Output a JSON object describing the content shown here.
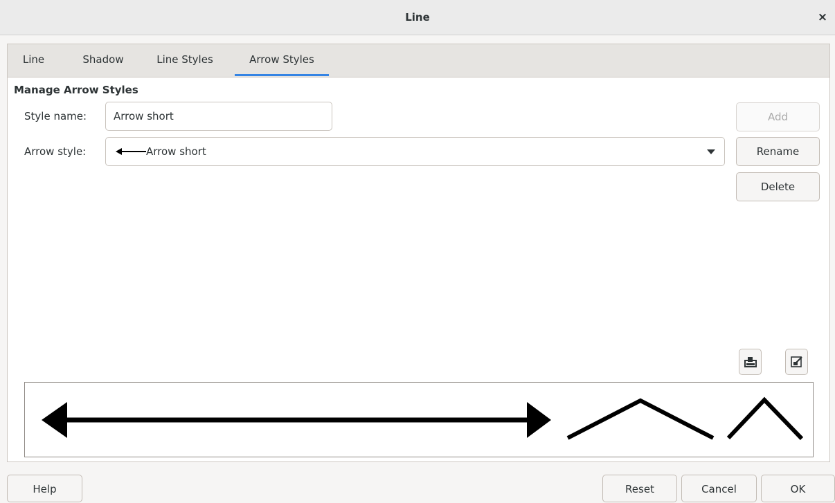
{
  "window": {
    "title": "Line",
    "close_glyph": "×"
  },
  "tabs": [
    {
      "label": "Line",
      "active": false
    },
    {
      "label": "Shadow",
      "active": false
    },
    {
      "label": "Line Styles",
      "active": false
    },
    {
      "label": "Arrow Styles",
      "active": true
    }
  ],
  "section_title": "Manage Arrow Styles",
  "style_name": {
    "label": "Style name:",
    "value": "Arrow short"
  },
  "arrow_style": {
    "label": "Arrow style:",
    "selected": "Arrow short"
  },
  "buttons": {
    "add": "Add",
    "rename": "Rename",
    "delete": "Delete",
    "help": "Help",
    "reset": "Reset",
    "cancel": "Cancel",
    "ok": "OK"
  },
  "icons": {
    "load": "load-arrow-styles-icon",
    "save": "save-arrow-styles-icon"
  },
  "colors": {
    "accent": "#3584e4",
    "preview_stroke": "#000000"
  }
}
